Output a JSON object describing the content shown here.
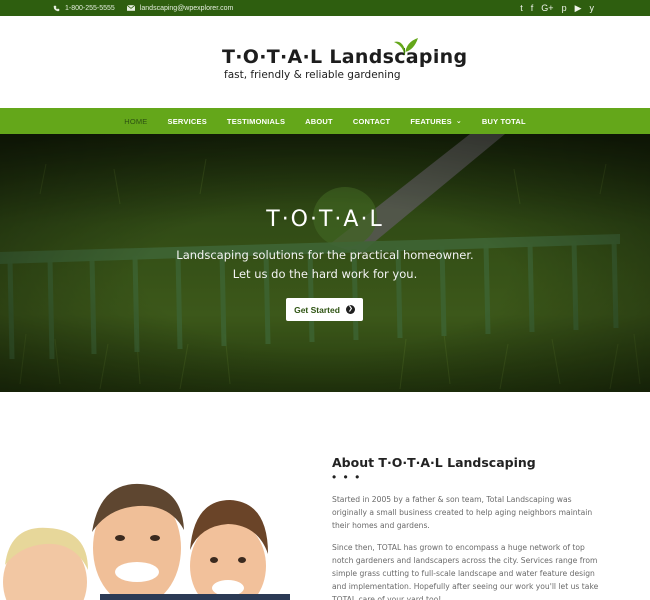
{
  "topbar": {
    "phone": "1-800-255-5555",
    "email": "landscaping@wpexplorer.com",
    "social_icons": [
      "twitter-icon",
      "facebook-icon",
      "google-plus-icon",
      "pinterest-icon",
      "youtube-icon",
      "yelp-icon"
    ],
    "social_glyphs": [
      "t",
      "f",
      "G+",
      "p",
      "▶",
      "y"
    ]
  },
  "logo": {
    "title": "T·O·T·A·L Landscaping",
    "tagline": "fast, friendly & reliable gardening"
  },
  "nav": {
    "items": [
      {
        "label": "HOME",
        "active": true
      },
      {
        "label": "SERVICES"
      },
      {
        "label": "TESTIMONIALS"
      },
      {
        "label": "ABOUT"
      },
      {
        "label": "CONTACT"
      },
      {
        "label": "FEATURES",
        "dropdown": true
      },
      {
        "label": "BUY TOTAL"
      }
    ]
  },
  "hero": {
    "title": "T·O·T·A·L",
    "line1": "Landscaping solutions for the practical homeowner.",
    "line2": "Let us do the hard work for you.",
    "button_label": "Get Started"
  },
  "about": {
    "title": "About T·O·T·A·L Landscaping",
    "dots": "• • •",
    "para1": "Started in 2005 by a father & son team, Total Landscaping was originally a small business created to help aging neighbors maintain their homes and gardens.",
    "para2": "Since then, TOTAL has grown to encompass a huge network of top notch gardeners and landscapers across the city. Services range from simple grass cutting to full-scale landscape and water feature design and implementation. Hopefully after seeing our work you'll let us take TOTAL care of your yard too!"
  },
  "colors": {
    "topbar": "#2e5e0f",
    "nav": "#64a71a",
    "nav_active": "#2e5312"
  }
}
